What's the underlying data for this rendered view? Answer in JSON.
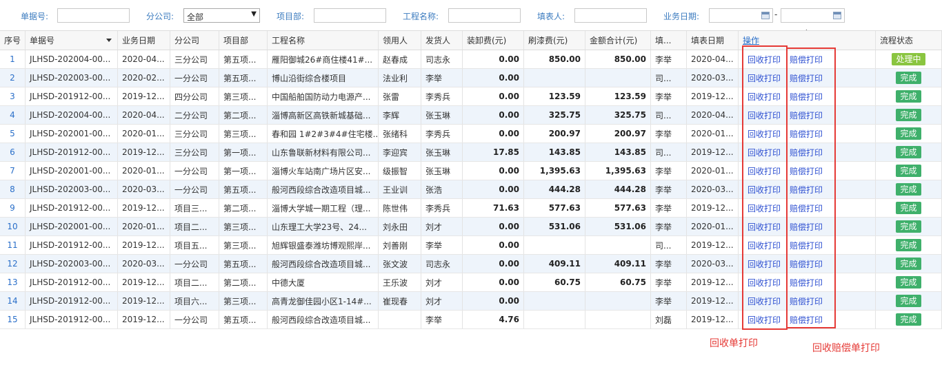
{
  "filters": {
    "doc_no_label": "单据号:",
    "branch_label": "分公司:",
    "branch_value": "全部",
    "project_dept_label": "项目部:",
    "project_name_label": "工程名称:",
    "filler_label": "填表人:",
    "biz_date_label": "业务日期:",
    "date_separator": "-"
  },
  "columns": [
    "序号",
    "单据号",
    "业务日期",
    "分公司",
    "项目部",
    "工程名称",
    "领用人",
    "发货人",
    "装卸费(元)",
    "刷漆费(元)",
    "金额合计(元)",
    "填...",
    "填表日期",
    "操作",
    "流程状态"
  ],
  "rows": [
    {
      "idx": "1",
      "doc": "JLHSD-202004-00...",
      "date": "2020-04...",
      "branch": "三分公司",
      "dept": "第五项...",
      "project": "雁阳御城26#商住楼41#...",
      "receiver": "赵春成",
      "shipper": "司志永",
      "load": "0.00",
      "paint": "850.00",
      "total": "850.00",
      "filler": "李举",
      "fill_date": "2020-04...",
      "op1": "回收打印",
      "op2": "赔偿打印",
      "status": "处理中",
      "status_type": "processing"
    },
    {
      "idx": "2",
      "doc": "JLHSD-202003-00...",
      "date": "2020-02...",
      "branch": "一分公司",
      "dept": "第五项...",
      "project": "博山沿街综合楼项目",
      "receiver": "法业利",
      "shipper": "李举",
      "load": "0.00",
      "paint": "",
      "total": "",
      "filler": "司...",
      "fill_date": "2020-03...",
      "op1": "回收打印",
      "op2": "赔偿打印",
      "status": "完成",
      "status_type": "done"
    },
    {
      "idx": "3",
      "doc": "JLHSD-201912-00...",
      "date": "2019-12...",
      "branch": "四分公司",
      "dept": "第三项...",
      "project": "中国船舶国防动力电源产...",
      "receiver": "张雷",
      "shipper": "李秀兵",
      "load": "0.00",
      "paint": "123.59",
      "total": "123.59",
      "filler": "李举",
      "fill_date": "2019-12...",
      "op1": "回收打印",
      "op2": "赔偿打印",
      "status": "完成",
      "status_type": "done"
    },
    {
      "idx": "4",
      "doc": "JLHSD-202004-00...",
      "date": "2020-04...",
      "branch": "二分公司",
      "dept": "第二项...",
      "project": "淄博高新区高铁新城基础...",
      "receiver": "李辉",
      "shipper": "张玉琳",
      "load": "0.00",
      "paint": "325.75",
      "total": "325.75",
      "filler": "司...",
      "fill_date": "2020-04...",
      "op1": "回收打印",
      "op2": "赔偿打印",
      "status": "完成",
      "status_type": "done"
    },
    {
      "idx": "5",
      "doc": "JLHSD-202001-00...",
      "date": "2020-01...",
      "branch": "三分公司",
      "dept": "第三项...",
      "project": "春和园 1#2#3#4#住宅楼...",
      "receiver": "张绪科",
      "shipper": "李秀兵",
      "load": "0.00",
      "paint": "200.97",
      "total": "200.97",
      "filler": "李举",
      "fill_date": "2020-01...",
      "op1": "回收打印",
      "op2": "赔偿打印",
      "status": "完成",
      "status_type": "done"
    },
    {
      "idx": "6",
      "doc": "JLHSD-201912-00...",
      "date": "2019-12...",
      "branch": "三分公司",
      "dept": "第一项...",
      "project": "山东鲁联新材料有限公司...",
      "receiver": "李迎宾",
      "shipper": "张玉琳",
      "load": "17.85",
      "paint": "143.85",
      "total": "143.85",
      "filler": "司...",
      "fill_date": "2019-12...",
      "op1": "回收打印",
      "op2": "赔偿打印",
      "status": "完成",
      "status_type": "done"
    },
    {
      "idx": "7",
      "doc": "JLHSD-202001-00...",
      "date": "2020-01...",
      "branch": "一分公司",
      "dept": "第一项...",
      "project": "淄博火车站南广场片区安...",
      "receiver": "级振智",
      "shipper": "张玉琳",
      "load": "0.00",
      "paint": "1,395.63",
      "total": "1,395.63",
      "filler": "李举",
      "fill_date": "2020-01...",
      "op1": "回收打印",
      "op2": "赔偿打印",
      "status": "完成",
      "status_type": "done"
    },
    {
      "idx": "8",
      "doc": "JLHSD-202003-00...",
      "date": "2020-03...",
      "branch": "一分公司",
      "dept": "第五项...",
      "project": "般河西段综合改造项目城...",
      "receiver": "王业训",
      "shipper": "张浩",
      "load": "0.00",
      "paint": "444.28",
      "total": "444.28",
      "filler": "李举",
      "fill_date": "2020-03...",
      "op1": "回收打印",
      "op2": "赔偿打印",
      "status": "完成",
      "status_type": "done"
    },
    {
      "idx": "9",
      "doc": "JLHSD-201912-00...",
      "date": "2019-12...",
      "branch": "项目三...",
      "dept": "第二项...",
      "project": "淄博大学城一期工程（理...",
      "receiver": "陈世伟",
      "shipper": "李秀兵",
      "load": "71.63",
      "paint": "577.63",
      "total": "577.63",
      "filler": "李举",
      "fill_date": "2019-12...",
      "op1": "回收打印",
      "op2": "赔偿打印",
      "status": "完成",
      "status_type": "done"
    },
    {
      "idx": "10",
      "doc": "JLHSD-202001-00...",
      "date": "2020-01...",
      "branch": "项目二...",
      "dept": "第三项...",
      "project": "山东理工大学23号、24...",
      "receiver": "刘永田",
      "shipper": "刘才",
      "load": "0.00",
      "paint": "531.06",
      "total": "531.06",
      "filler": "李举",
      "fill_date": "2020-01...",
      "op1": "回收打印",
      "op2": "赔偿打印",
      "status": "完成",
      "status_type": "done"
    },
    {
      "idx": "11",
      "doc": "JLHSD-201912-00...",
      "date": "2019-12...",
      "branch": "项目五...",
      "dept": "第三项...",
      "project": "旭辉银盛泰潍坊博观熙岸...",
      "receiver": "刘善刚",
      "shipper": "李举",
      "load": "0.00",
      "paint": "",
      "total": "",
      "filler": "司...",
      "fill_date": "2019-12...",
      "op1": "回收打印",
      "op2": "赔偿打印",
      "status": "完成",
      "status_type": "done"
    },
    {
      "idx": "12",
      "doc": "JLHSD-202003-00...",
      "date": "2020-03...",
      "branch": "一分公司",
      "dept": "第五项...",
      "project": "般河西段综合改造项目城...",
      "receiver": "张文波",
      "shipper": "司志永",
      "load": "0.00",
      "paint": "409.11",
      "total": "409.11",
      "filler": "李举",
      "fill_date": "2020-03...",
      "op1": "回收打印",
      "op2": "赔偿打印",
      "status": "完成",
      "status_type": "done"
    },
    {
      "idx": "13",
      "doc": "JLHSD-201912-00...",
      "date": "2019-12...",
      "branch": "项目二...",
      "dept": "第二项...",
      "project": "中德大厦",
      "receiver": "王乐波",
      "shipper": "刘才",
      "load": "0.00",
      "paint": "60.75",
      "total": "60.75",
      "filler": "李举",
      "fill_date": "2019-12...",
      "op1": "回收打印",
      "op2": "赔偿打印",
      "status": "完成",
      "status_type": "done"
    },
    {
      "idx": "14",
      "doc": "JLHSD-201912-00...",
      "date": "2019-12...",
      "branch": "项目六...",
      "dept": "第三项...",
      "project": "高青龙御佳园小区1-14#...",
      "receiver": "崔现春",
      "shipper": "刘才",
      "load": "0.00",
      "paint": "",
      "total": "",
      "filler": "李举",
      "fill_date": "2019-12...",
      "op1": "回收打印",
      "op2": "赔偿打印",
      "status": "完成",
      "status_type": "done"
    },
    {
      "idx": "15",
      "doc": "JLHSD-201912-00...",
      "date": "2019-12...",
      "branch": "一分公司",
      "dept": "第五项...",
      "project": "般河西段综合改造项目城...",
      "receiver": "",
      "shipper": "李举",
      "load": "4.76",
      "paint": "",
      "total": "",
      "filler": "刘磊",
      "fill_date": "2019-12...",
      "op1": "回收打印",
      "op2": "赔偿打印",
      "status": "完成",
      "status_type": "done"
    }
  ],
  "annotations": {
    "recycle_label": "回收单打印",
    "compensation_label": "回收赔偿单打印"
  },
  "colors": {
    "annotation": "#e53935",
    "done": "#3fb06b",
    "processing": "#8ac540",
    "link": "#2d4fd1"
  }
}
